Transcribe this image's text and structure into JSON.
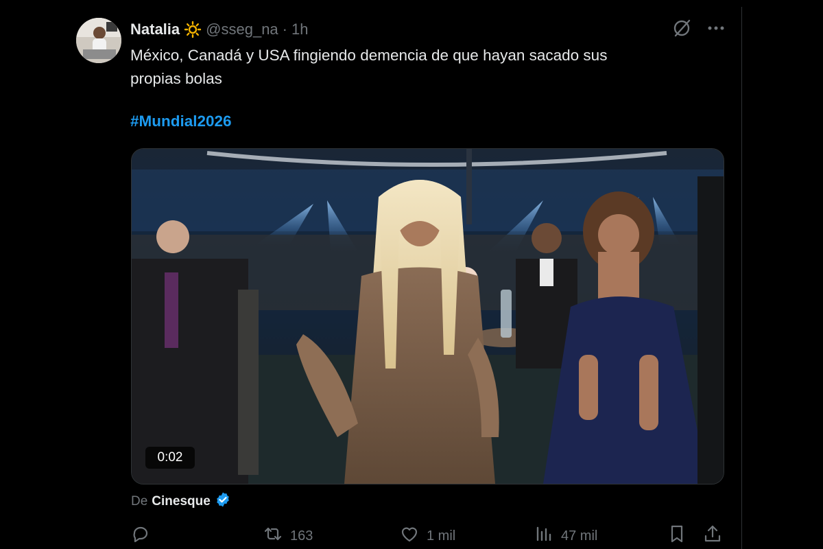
{
  "tweet": {
    "author": {
      "display_name": "Natalia",
      "handle": "@sseg_na",
      "separator": "·",
      "time": "1h"
    },
    "text_lines": [
      "México, Canadá y USA fingiendo demencia de que hayan sacado sus",
      "propias bolas"
    ],
    "hashtag": "#Mundial2026",
    "media": {
      "duration": "0:02"
    },
    "source": {
      "prefix": "De",
      "name": "Cinesque"
    },
    "actions": {
      "reposts": "163",
      "likes": "1 mil",
      "views": "47 mil"
    }
  },
  "colors": {
    "background": "#000000",
    "text": "#e7e9ea",
    "muted": "#71767b",
    "accent": "#1d9bf0",
    "divider": "#2f3336"
  },
  "icons": {
    "author_badge": "sun-icon",
    "top_actions": [
      "grok-icon",
      "more-icon"
    ],
    "verified": "verified-badge-icon",
    "action_bar": [
      "reply-icon",
      "repost-icon",
      "like-icon",
      "views-icon",
      "bookmark-icon",
      "share-icon"
    ]
  }
}
